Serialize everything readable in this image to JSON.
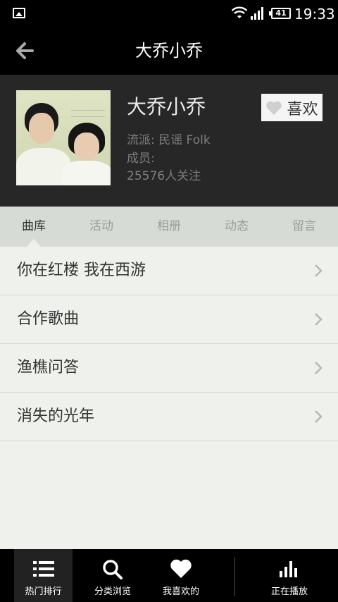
{
  "status_bar": {
    "time": "19:33",
    "battery": "41"
  },
  "header": {
    "title": "大乔小乔"
  },
  "artist": {
    "name": "大乔小乔",
    "like_label": "喜欢",
    "genre": "流派: 民谣 Folk",
    "members": "成员:",
    "followers": "25576人关注"
  },
  "tabs": [
    {
      "label": "曲库",
      "active": true
    },
    {
      "label": "活动",
      "active": false
    },
    {
      "label": "相册",
      "active": false
    },
    {
      "label": "动态",
      "active": false
    },
    {
      "label": "留言",
      "active": false
    }
  ],
  "songs": [
    {
      "label": "你在红楼 我在西游"
    },
    {
      "label": "合作歌曲"
    },
    {
      "label": "渔樵问答"
    },
    {
      "label": "消失的光年"
    }
  ],
  "bottom_nav": [
    {
      "label": "热门排行",
      "icon": "list-icon",
      "active": true
    },
    {
      "label": "分类浏览",
      "icon": "search-icon",
      "active": false
    },
    {
      "label": "我喜欢的",
      "icon": "heart-icon",
      "active": false
    },
    {
      "label": "正在播放",
      "icon": "equalizer-icon",
      "active": false
    }
  ],
  "colors": {
    "header_bg": "#000000",
    "artist_bg": "#272727",
    "tab_bg": "#d6dbd6",
    "list_bg": "#eef1ec"
  }
}
